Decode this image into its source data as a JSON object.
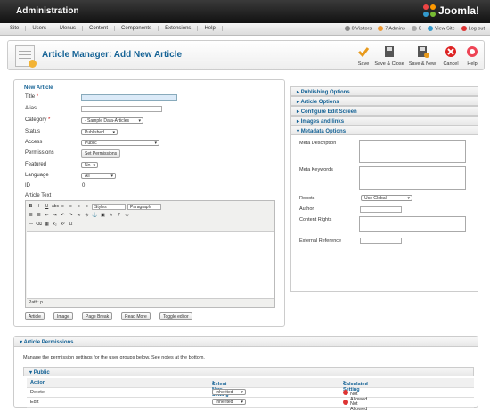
{
  "app": {
    "title": "Administration",
    "logo_text": "Joomla!"
  },
  "menu": [
    "Site",
    "Users",
    "Menus",
    "Content",
    "Components",
    "Extensions",
    "Help"
  ],
  "status": {
    "visitors": "0 Visitors",
    "admins": "7 Admins",
    "messages": "0",
    "view_site": "View Site",
    "logout": "Log out"
  },
  "toolbar": {
    "page_title": "Article Manager: Add New Article",
    "save": "Save",
    "save_close": "Save & Close",
    "save_new": "Save & New",
    "cancel": "Cancel",
    "help": "Help"
  },
  "form": {
    "section_title": "New Article",
    "title_label": "Title",
    "alias_label": "Alias",
    "category_label": "Category",
    "category_value": "- Sample Data-Articles",
    "status_label": "Status",
    "status_value": "Published",
    "access_label": "Access",
    "access_value": "Public",
    "permissions_label": "Permissions",
    "permissions_button": "Set Permissions",
    "featured_label": "Featured",
    "featured_value": "No",
    "language_label": "Language",
    "language_value": "All",
    "id_label": "ID",
    "id_value": "0",
    "article_text_label": "Article Text"
  },
  "editor": {
    "styles": "Styles",
    "format": "Paragraph",
    "path": "Path: p"
  },
  "editor_buttons": {
    "article": "Article",
    "image": "Image",
    "page_break": "Page Break",
    "read_more": "Read More",
    "toggle": "Toggle editor"
  },
  "accordion": [
    "Publishing Options",
    "Article Options",
    "Configure Edit Screen",
    "Images and links",
    "Metadata Options"
  ],
  "metadata": {
    "description": "Meta Description",
    "keywords": "Meta Keywords",
    "robots": "Robots",
    "robots_value": "Use Global",
    "author": "Author",
    "rights": "Content Rights",
    "external": "External Reference"
  },
  "permissions": {
    "title": "Article Permissions",
    "description": "Manage the permission settings for the user groups below. See notes at the bottom.",
    "group": "Public",
    "headers": {
      "action": "Action",
      "new_setting": "Select New Setting",
      "new_sup": "1",
      "calculated": "Calculated Setting",
      "calc_sup": "2"
    },
    "rows": [
      {
        "action": "Delete",
        "setting": "Inherited",
        "calculated": "Not Allowed"
      },
      {
        "action": "Edit",
        "setting": "Inherited",
        "calculated": "Not Allowed"
      }
    ]
  }
}
